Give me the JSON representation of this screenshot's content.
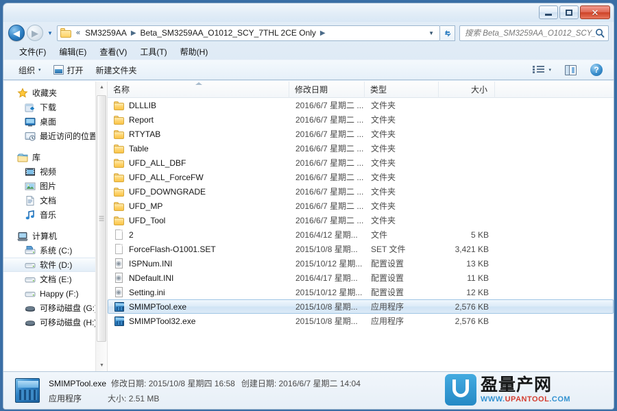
{
  "window": {
    "controls": {
      "minimize": "–",
      "maximize": "□",
      "close": "✕"
    }
  },
  "address": {
    "back_label": "◀",
    "forward_label": "▶",
    "history_label": "▾",
    "folder_icon": "folder-icon",
    "overflow": "«",
    "crumbs": [
      {
        "label": "SM3259AA"
      },
      {
        "label": "Beta_SM3259AA_O1012_SCY_7THL 2CE Only"
      }
    ],
    "dropdown": "▾",
    "refresh_label": "↻"
  },
  "search": {
    "placeholder": "搜索 Beta_SM3259AA_O1012_SCY_...",
    "value": "",
    "icon": "search-icon"
  },
  "menubar": {
    "items": [
      {
        "label": "文件(F)",
        "name": "menu-file"
      },
      {
        "label": "编辑(E)",
        "name": "menu-edit"
      },
      {
        "label": "查看(V)",
        "name": "menu-view"
      },
      {
        "label": "工具(T)",
        "name": "menu-tools"
      },
      {
        "label": "帮助(H)",
        "name": "menu-help"
      }
    ]
  },
  "commandbar": {
    "organize": "组织",
    "organize_caret": "▾",
    "open": "打开",
    "new_folder": "新建文件夹",
    "view_caret": "▾"
  },
  "sidebar": {
    "groups": [
      {
        "header": {
          "label": "收藏夹",
          "icon": "star-icon",
          "name": "sidebar-group-favorites"
        },
        "items": [
          {
            "label": "下载",
            "icon": "download-icon",
            "name": "sidebar-item-downloads"
          },
          {
            "label": "桌面",
            "icon": "desktop-icon",
            "name": "sidebar-item-desktop"
          },
          {
            "label": "最近访问的位置",
            "icon": "recent-places-icon",
            "name": "sidebar-item-recent"
          }
        ]
      },
      {
        "header": {
          "label": "库",
          "icon": "library-icon",
          "name": "sidebar-group-libraries"
        },
        "items": [
          {
            "label": "视频",
            "icon": "video-icon",
            "name": "sidebar-item-videos"
          },
          {
            "label": "图片",
            "icon": "pictures-icon",
            "name": "sidebar-item-pictures"
          },
          {
            "label": "文档",
            "icon": "documents-icon",
            "name": "sidebar-item-documents"
          },
          {
            "label": "音乐",
            "icon": "music-icon",
            "name": "sidebar-item-music"
          }
        ]
      },
      {
        "header": {
          "label": "计算机",
          "icon": "computer-icon",
          "name": "sidebar-group-computer"
        },
        "items": [
          {
            "label": "系统 (C:)",
            "icon": "system-drive-icon",
            "name": "sidebar-item-drive-c"
          },
          {
            "label": "软件 (D:)",
            "icon": "drive-icon",
            "name": "sidebar-item-drive-d",
            "selected": true
          },
          {
            "label": "文档 (E:)",
            "icon": "drive-icon",
            "name": "sidebar-item-drive-e"
          },
          {
            "label": "Happy (F:)",
            "icon": "drive-icon",
            "name": "sidebar-item-drive-f"
          },
          {
            "label": "可移动磁盘 (G:)",
            "icon": "removable-drive-icon",
            "name": "sidebar-item-drive-g"
          },
          {
            "label": "可移动磁盘 (H:)",
            "icon": "removable-drive-icon",
            "name": "sidebar-item-drive-h"
          }
        ]
      }
    ],
    "scroll_up": "▲",
    "scroll_down": "▼"
  },
  "filelist": {
    "columns": [
      {
        "label": "名称",
        "name": "column-name"
      },
      {
        "label": "修改日期",
        "name": "column-date-modified"
      },
      {
        "label": "类型",
        "name": "column-type"
      },
      {
        "label": "大小",
        "name": "column-size"
      }
    ],
    "sort_column": "名称",
    "sort_direction": "ascending",
    "rows": [
      {
        "name": "DLLLIB",
        "date": "2016/6/7 星期二 ...",
        "type": "文件夹",
        "size": "",
        "icon": "folder-icon"
      },
      {
        "name": "Report",
        "date": "2016/6/7 星期二 ...",
        "type": "文件夹",
        "size": "",
        "icon": "folder-icon"
      },
      {
        "name": "RTYTAB",
        "date": "2016/6/7 星期二 ...",
        "type": "文件夹",
        "size": "",
        "icon": "folder-icon"
      },
      {
        "name": "Table",
        "date": "2016/6/7 星期二 ...",
        "type": "文件夹",
        "size": "",
        "icon": "folder-icon"
      },
      {
        "name": "UFD_ALL_DBF",
        "date": "2016/6/7 星期二 ...",
        "type": "文件夹",
        "size": "",
        "icon": "folder-icon"
      },
      {
        "name": "UFD_ALL_ForceFW",
        "date": "2016/6/7 星期二 ...",
        "type": "文件夹",
        "size": "",
        "icon": "folder-icon"
      },
      {
        "name": "UFD_DOWNGRADE",
        "date": "2016/6/7 星期二 ...",
        "type": "文件夹",
        "size": "",
        "icon": "folder-icon"
      },
      {
        "name": "UFD_MP",
        "date": "2016/6/7 星期二 ...",
        "type": "文件夹",
        "size": "",
        "icon": "folder-icon"
      },
      {
        "name": "UFD_Tool",
        "date": "2016/6/7 星期二 ...",
        "type": "文件夹",
        "size": "",
        "icon": "folder-icon"
      },
      {
        "name": "2",
        "date": "2016/4/12 星期...",
        "type": "文件",
        "size": "5 KB",
        "icon": "file-icon"
      },
      {
        "name": "ForceFlash-O1001.SET",
        "date": "2015/10/8 星期...",
        "type": "SET 文件",
        "size": "3,421 KB",
        "icon": "file-icon"
      },
      {
        "name": "ISPNum.INI",
        "date": "2015/10/12 星期...",
        "type": "配置设置",
        "size": "13 KB",
        "icon": "ini-icon"
      },
      {
        "name": "NDefault.INI",
        "date": "2016/4/17 星期...",
        "type": "配置设置",
        "size": "11 KB",
        "icon": "ini-icon"
      },
      {
        "name": "Setting.ini",
        "date": "2015/10/12 星期...",
        "type": "配置设置",
        "size": "12 KB",
        "icon": "ini-icon"
      },
      {
        "name": "SMIMPTool.exe",
        "date": "2015/10/8 星期...",
        "type": "应用程序",
        "size": "2,576 KB",
        "icon": "exe-icon",
        "selected": true
      },
      {
        "name": "SMIMPTool32.exe",
        "date": "2015/10/8 星期...",
        "type": "应用程序",
        "size": "2,576 KB",
        "icon": "exe-icon"
      }
    ]
  },
  "statusbar": {
    "filename": "SMIMPTool.exe",
    "modified_label": "修改日期:",
    "modified_value": "2015/10/8 星期四 16:58",
    "created_label": "创建日期:",
    "created_value": "2016/6/7 星期二 14:04",
    "type": "应用程序",
    "size_label": "大小:",
    "size_value": "2.51 MB",
    "icon": "exe-icon"
  },
  "watermark": {
    "cn_text": "盈量产网",
    "url_www": "WWW.",
    "url_mid": "UPANTOOL",
    "url_com": ".COM"
  }
}
